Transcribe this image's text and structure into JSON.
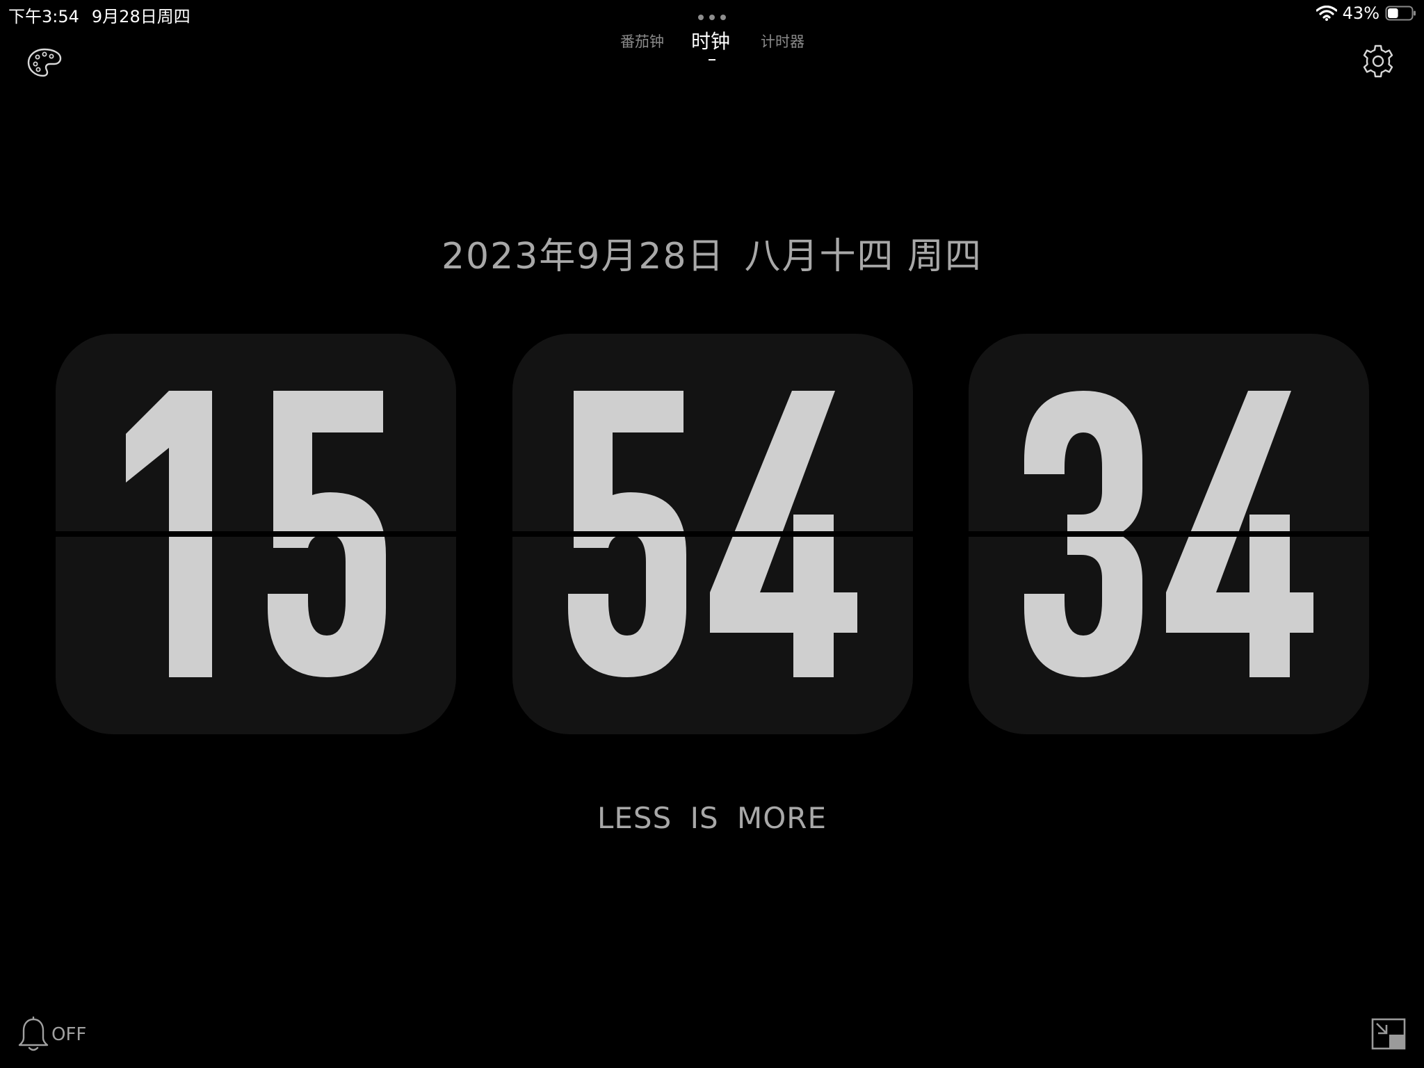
{
  "status_bar": {
    "time": "下午3:54",
    "date": "9月28日周四",
    "battery_percent": "43%",
    "battery_level": 0.43,
    "wifi_icon": "wifi-icon",
    "battery_icon": "battery-icon"
  },
  "tabs": [
    {
      "label": "番茄钟",
      "active": false
    },
    {
      "label": "时钟",
      "active": true
    },
    {
      "label": "计时器",
      "active": false
    }
  ],
  "toolbar": {
    "theme_icon": "palette-icon",
    "settings_icon": "gear-icon"
  },
  "clock": {
    "date_text": "2023年9月28日",
    "lunar_text": "八月十四 周四",
    "hours": "15",
    "minutes": "54",
    "seconds": "34"
  },
  "motto": "LESS IS MORE",
  "alarm": {
    "icon": "bell-icon",
    "label": "OFF"
  },
  "pip": {
    "icon": "picture-in-picture-icon"
  },
  "colors": {
    "background": "#000000",
    "card": "#131313",
    "digit": "#cfcfcf",
    "secondary_text": "#a8a8a8",
    "inactive_tab": "#8a8a8a"
  }
}
